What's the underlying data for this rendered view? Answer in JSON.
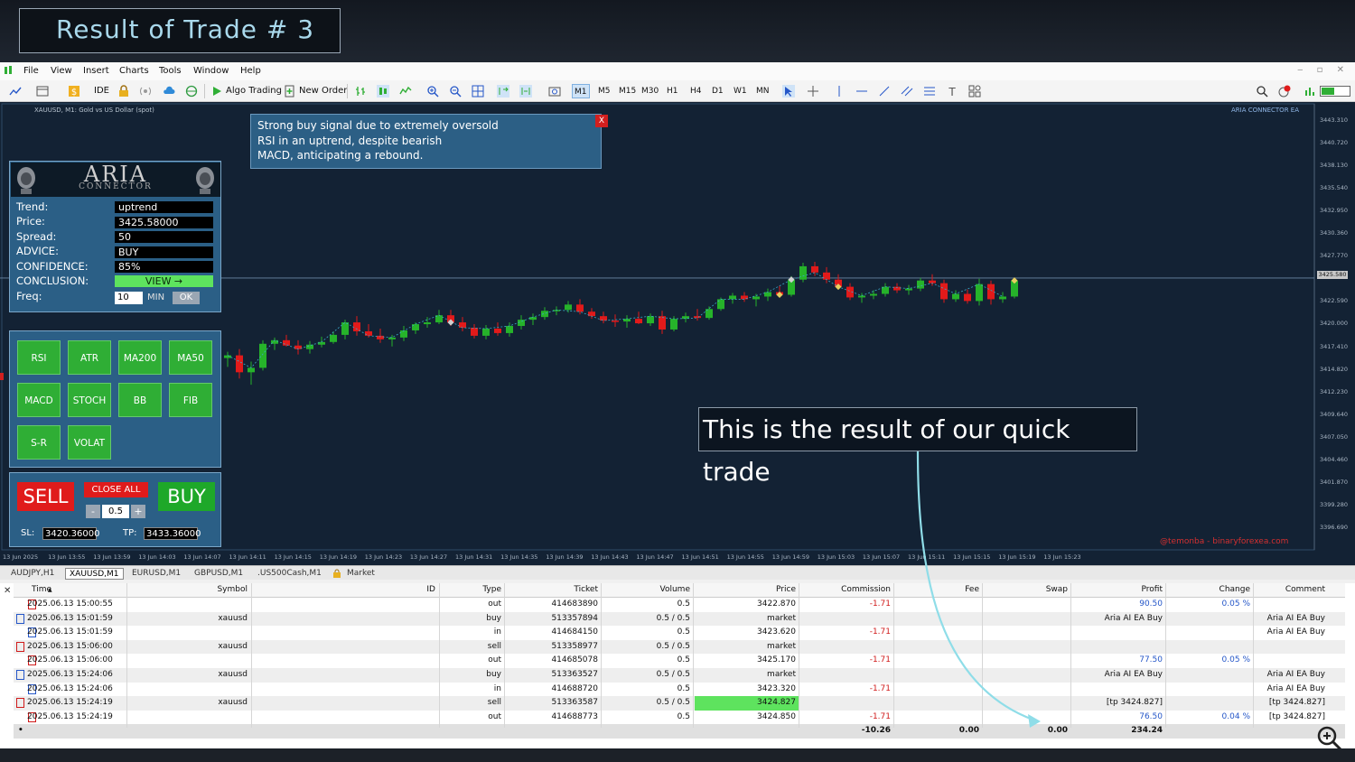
{
  "banner": {
    "title": "Result of Trade # 3"
  },
  "menu": [
    "File",
    "View",
    "Insert",
    "Charts",
    "Tools",
    "Window",
    "Help"
  ],
  "toolbar": {
    "ide": "IDE",
    "algo_trading": "Algo Trading",
    "new_order": "New Order",
    "timeframes": [
      "M1",
      "M5",
      "M15",
      "M30",
      "H1",
      "H4",
      "D1",
      "W1",
      "MN"
    ],
    "active_timeframe": "M1",
    "notification_count": "1"
  },
  "chart": {
    "symbol_label": "XAUUSD, M1:  Gold vs US Dollar (spot)",
    "ea_label": "ARIA CONNECTOR EA",
    "current_price": "3425.580",
    "watermark": "@temonba - binaryforexea.com",
    "price_ticks": [
      "3443.310",
      "3440.720",
      "3438.130",
      "3435.540",
      "3432.950",
      "3430.360",
      "3427.770",
      "3425.580",
      "3422.590",
      "3420.000",
      "3417.410",
      "3414.820",
      "3412.230",
      "3409.640",
      "3407.050",
      "3404.460",
      "3401.870",
      "3399.280",
      "3396.690"
    ],
    "time_ticks": [
      "13 Jun 2025",
      "13 Jun 13:55",
      "13 Jun 13:59",
      "13 Jun 14:03",
      "13 Jun 14:07",
      "13 Jun 14:11",
      "13 Jun 14:15",
      "13 Jun 14:19",
      "13 Jun 14:23",
      "13 Jun 14:27",
      "13 Jun 14:31",
      "13 Jun 14:35",
      "13 Jun 14:39",
      "13 Jun 14:43",
      "13 Jun 14:47",
      "13 Jun 14:51",
      "13 Jun 14:55",
      "13 Jun 14:59",
      "13 Jun 15:03",
      "13 Jun 15:07",
      "13 Jun 15:11",
      "13 Jun 15:15",
      "13 Jun 15:19",
      "13 Jun 15:23"
    ]
  },
  "chart_data": {
    "type": "candlestick",
    "title": "XAUUSD, M1",
    "ylim": [
      3396.69,
      3443.31
    ],
    "candles": [
      [
        3416.6,
        3417.3,
        3415.6,
        3416.9
      ],
      [
        3416.9,
        3417.6,
        3414.3,
        3415.0
      ],
      [
        3415.0,
        3416.2,
        3413.6,
        3415.5
      ],
      [
        3415.5,
        3418.6,
        3415.2,
        3418.2
      ],
      [
        3418.2,
        3418.9,
        3417.5,
        3418.6
      ],
      [
        3418.6,
        3419.2,
        3417.9,
        3418.0
      ],
      [
        3418.0,
        3418.6,
        3417.0,
        3417.6
      ],
      [
        3417.6,
        3418.5,
        3417.1,
        3418.1
      ],
      [
        3418.1,
        3419.0,
        3417.8,
        3418.4
      ],
      [
        3418.4,
        3419.6,
        3418.2,
        3419.2
      ],
      [
        3419.2,
        3420.9,
        3418.7,
        3420.6
      ],
      [
        3420.6,
        3421.3,
        3419.1,
        3419.6
      ],
      [
        3419.6,
        3420.4,
        3418.9,
        3419.1
      ],
      [
        3419.1,
        3419.9,
        3418.3,
        3418.7
      ],
      [
        3418.7,
        3419.2,
        3417.9,
        3418.9
      ],
      [
        3418.9,
        3420.2,
        3418.5,
        3419.7
      ],
      [
        3419.7,
        3420.6,
        3419.3,
        3420.4
      ],
      [
        3420.4,
        3421.2,
        3420.0,
        3420.6
      ],
      [
        3420.6,
        3422.0,
        3420.4,
        3421.4
      ],
      [
        3421.4,
        3422.0,
        3420.2,
        3420.6
      ],
      [
        3420.6,
        3421.2,
        3419.6,
        3420.0
      ],
      [
        3420.0,
        3420.4,
        3418.8,
        3419.1
      ],
      [
        3419.1,
        3420.3,
        3418.7,
        3419.9
      ],
      [
        3419.9,
        3420.6,
        3419.1,
        3419.4
      ],
      [
        3419.4,
        3420.6,
        3419.0,
        3420.2
      ],
      [
        3420.2,
        3421.4,
        3419.8,
        3420.9
      ],
      [
        3420.9,
        3421.6,
        3420.3,
        3421.2
      ],
      [
        3421.2,
        3422.3,
        3420.9,
        3421.9
      ],
      [
        3421.9,
        3422.4,
        3421.4,
        3422.0
      ],
      [
        3422.0,
        3423.0,
        3421.7,
        3422.6
      ],
      [
        3422.6,
        3423.2,
        3421.5,
        3421.8
      ],
      [
        3421.8,
        3422.2,
        3421.0,
        3421.3
      ],
      [
        3421.3,
        3421.8,
        3420.5,
        3420.8
      ],
      [
        3420.8,
        3421.5,
        3420.1,
        3420.7
      ],
      [
        3420.7,
        3421.4,
        3420.0,
        3421.0
      ],
      [
        3421.0,
        3421.8,
        3420.4,
        3420.5
      ],
      [
        3420.5,
        3421.6,
        3420.2,
        3421.3
      ],
      [
        3421.3,
        3421.9,
        3419.3,
        3419.8
      ],
      [
        3419.8,
        3421.3,
        3419.6,
        3421.0
      ],
      [
        3421.0,
        3421.7,
        3420.6,
        3421.3
      ],
      [
        3421.3,
        3422.1,
        3420.8,
        3421.1
      ],
      [
        3421.1,
        3422.4,
        3420.9,
        3422.1
      ],
      [
        3422.1,
        3423.4,
        3421.9,
        3423.2
      ],
      [
        3423.2,
        3423.9,
        3422.7,
        3423.6
      ],
      [
        3423.6,
        3424.0,
        3422.9,
        3423.2
      ],
      [
        3423.2,
        3423.8,
        3422.4,
        3423.5
      ],
      [
        3423.5,
        3424.4,
        3423.0,
        3424.0
      ],
      [
        3424.0,
        3424.7,
        3423.4,
        3423.7
      ],
      [
        3423.7,
        3425.8,
        3423.5,
        3425.4
      ],
      [
        3425.4,
        3427.3,
        3425.1,
        3426.9
      ],
      [
        3426.9,
        3427.4,
        3425.8,
        3426.2
      ],
      [
        3426.2,
        3426.8,
        3425.0,
        3425.4
      ],
      [
        3425.4,
        3426.0,
        3424.3,
        3424.6
      ],
      [
        3424.6,
        3425.0,
        3423.1,
        3423.4
      ],
      [
        3423.4,
        3423.9,
        3422.8,
        3423.6
      ],
      [
        3423.6,
        3424.2,
        3423.2,
        3423.8
      ],
      [
        3423.8,
        3425.0,
        3423.5,
        3424.6
      ],
      [
        3424.6,
        3425.0,
        3423.9,
        3424.2
      ],
      [
        3424.2,
        3424.8,
        3423.7,
        3424.4
      ],
      [
        3424.4,
        3425.6,
        3424.1,
        3425.3
      ],
      [
        3425.3,
        3426.0,
        3424.7,
        3425.0
      ],
      [
        3425.0,
        3425.4,
        3422.8,
        3423.2
      ],
      [
        3423.2,
        3424.2,
        3422.9,
        3423.8
      ],
      [
        3423.8,
        3424.3,
        3422.7,
        3423.0
      ],
      [
        3423.0,
        3425.5,
        3422.5,
        3424.9
      ],
      [
        3424.9,
        3425.3,
        3422.6,
        3423.2
      ],
      [
        3423.2,
        3424.0,
        3422.8,
        3423.5
      ],
      [
        3423.5,
        3425.6,
        3423.3,
        3425.3
      ]
    ]
  },
  "signal": {
    "close": "X",
    "lines": [
      "Strong buy signal due to extremely oversold",
      "RSI in an uptrend, despite bearish",
      "MACD, anticipating a rebound."
    ]
  },
  "aria": {
    "title": "ARIA",
    "subtitle": "CONNECTOR",
    "rows": [
      {
        "label": "Trend:",
        "value": "uptrend"
      },
      {
        "label": "Price:",
        "value": "3425.58000"
      },
      {
        "label": "Spread:",
        "value": "50"
      },
      {
        "label": "ADVICE:",
        "value": " BUY"
      },
      {
        "label": "CONFIDENCE:",
        "value": " 85%"
      }
    ],
    "conclusion_label": "CONCLUSION:",
    "conclusion_button": "VIEW →",
    "freq_label": "Freq:",
    "freq_value": "10",
    "freq_unit": "MIN",
    "ok": "OK"
  },
  "indicators": [
    "RSI",
    "ATR",
    "MA200",
    "MA50",
    "MACD",
    "STOCH",
    "BB",
    "FIB",
    "S-R",
    "VOLAT"
  ],
  "trade": {
    "sell": "SELL",
    "buy": "BUY",
    "close_all": "CLOSE ALL",
    "minus": "-",
    "plus": "+",
    "lot": "0.5",
    "sl_label": "SL:",
    "sl_value": "3420.36000",
    "tp_label": "TP:",
    "tp_value": "3433.36000"
  },
  "callout": "This is the result of our quick trade",
  "tabs": [
    "AUDJPY,H1",
    "XAUUSD,M1",
    "EURUSD,M1",
    "GBPUSD,M1",
    ".US500Cash,M1",
    "Market"
  ],
  "active_tab": "XAUUSD,M1",
  "history": {
    "columns": [
      "Time",
      "Symbol",
      "ID",
      "Type",
      "Ticket",
      "Volume",
      "Price",
      "Commission",
      "Fee",
      "Swap",
      "Profit",
      "Change",
      "Comment"
    ],
    "rows": [
      {
        "kind": "deal-out",
        "time": "2025.06.13 15:00:55",
        "symbol": "",
        "ticket": "414683890",
        "type": "out",
        "volume": "0.5",
        "price": "3422.870",
        "commission": "-1.71",
        "profit": "90.50",
        "change": "0.05 %",
        "comment": ""
      },
      {
        "kind": "order-buy",
        "time": "2025.06.13 15:01:59",
        "symbol": "xauusd",
        "ticket": "513357894",
        "type": "buy",
        "volume": "0.5 / 0.5",
        "price": "market",
        "commission": "",
        "profit": "Aria AI EA Buy",
        "change": "",
        "comment": "Aria AI EA Buy"
      },
      {
        "kind": "deal-in",
        "time": "2025.06.13 15:01:59",
        "symbol": "",
        "ticket": "414684150",
        "type": "in",
        "volume": "0.5",
        "price": "3423.620",
        "commission": "-1.71",
        "profit": "",
        "change": "",
        "comment": "Aria AI EA Buy"
      },
      {
        "kind": "order-sell",
        "time": "2025.06.13 15:06:00",
        "symbol": "xauusd",
        "ticket": "513358977",
        "type": "sell",
        "volume": "0.5 / 0.5",
        "price": "market",
        "commission": "",
        "profit": "",
        "change": "",
        "comment": ""
      },
      {
        "kind": "deal-out",
        "time": "2025.06.13 15:06:00",
        "symbol": "",
        "ticket": "414685078",
        "type": "out",
        "volume": "0.5",
        "price": "3425.170",
        "commission": "-1.71",
        "profit": "77.50",
        "change": "0.05 %",
        "comment": ""
      },
      {
        "kind": "order-buy",
        "time": "2025.06.13 15:24:06",
        "symbol": "xauusd",
        "ticket": "513363527",
        "type": "buy",
        "volume": "0.5 / 0.5",
        "price": "market",
        "commission": "",
        "profit": "Aria AI EA Buy",
        "change": "",
        "comment": "Aria AI EA Buy"
      },
      {
        "kind": "deal-in",
        "time": "2025.06.13 15:24:06",
        "symbol": "",
        "ticket": "414688720",
        "type": "in",
        "volume": "0.5",
        "price": "3423.320",
        "commission": "-1.71",
        "profit": "",
        "change": "",
        "comment": "Aria AI EA Buy"
      },
      {
        "kind": "order-sell",
        "time": "2025.06.13 15:24:19",
        "symbol": "xauusd",
        "ticket": "513363587",
        "type": "sell",
        "volume": "0.5 / 0.5",
        "price": "3424.827",
        "commission": "",
        "profit": "[tp 3424.827]",
        "change": "",
        "comment": "[tp 3424.827]"
      },
      {
        "kind": "deal-out",
        "time": "2025.06.13 15:24:19",
        "symbol": "",
        "ticket": "414688773",
        "type": "out",
        "volume": "0.5",
        "price": "3424.850",
        "commission": "-1.71",
        "profit": "76.50",
        "change": "0.04 %",
        "comment": "[tp 3424.827]"
      }
    ],
    "totals": {
      "commission": "-10.26",
      "fee": "0.00",
      "swap": "0.00",
      "profit": "234.24"
    }
  },
  "colors": {
    "bull": "#26b32a",
    "bear": "#e21a1a",
    "chart_bg": "#132234",
    "panel": "#2b5f86",
    "highlight": "#5ee35e",
    "arrow": "#8fdde8"
  }
}
